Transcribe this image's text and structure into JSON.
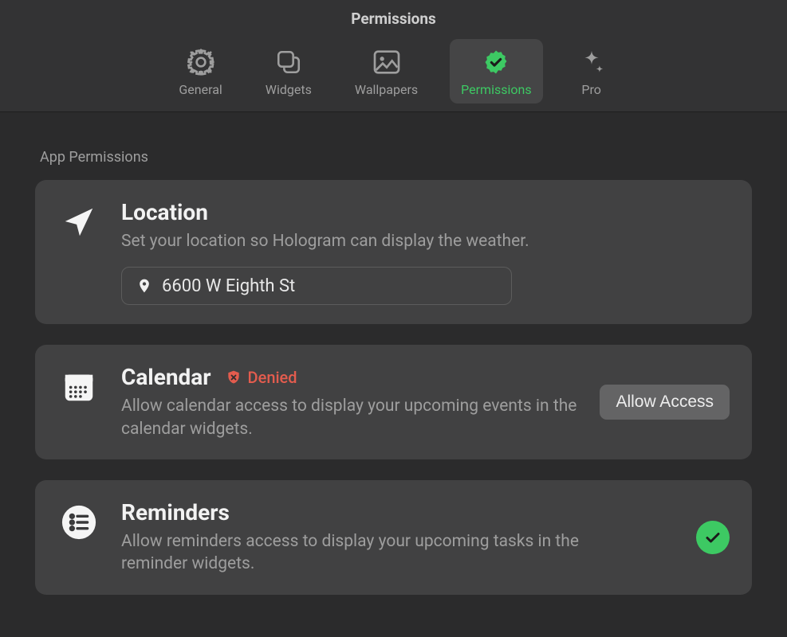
{
  "window_title": "Permissions",
  "tabs": {
    "general": {
      "label": "General"
    },
    "widgets": {
      "label": "Widgets"
    },
    "wallpapers": {
      "label": "Wallpapers"
    },
    "permissions": {
      "label": "Permissions",
      "active": true
    },
    "pro": {
      "label": "Pro"
    }
  },
  "section_heading": "App Permissions",
  "location": {
    "title": "Location",
    "description": "Set your location so Hologram can display the weather.",
    "value": "6600 W Eighth St"
  },
  "calendar": {
    "title": "Calendar",
    "status_label": "Denied",
    "description": "Allow calendar access to display your upcoming events in the calendar widgets.",
    "action_label": "Allow Access"
  },
  "reminders": {
    "title": "Reminders",
    "description": "Allow reminders access to display your upcoming tasks in the reminder widgets."
  },
  "colors": {
    "accent": "#3dc963",
    "danger": "#e35c4e"
  }
}
